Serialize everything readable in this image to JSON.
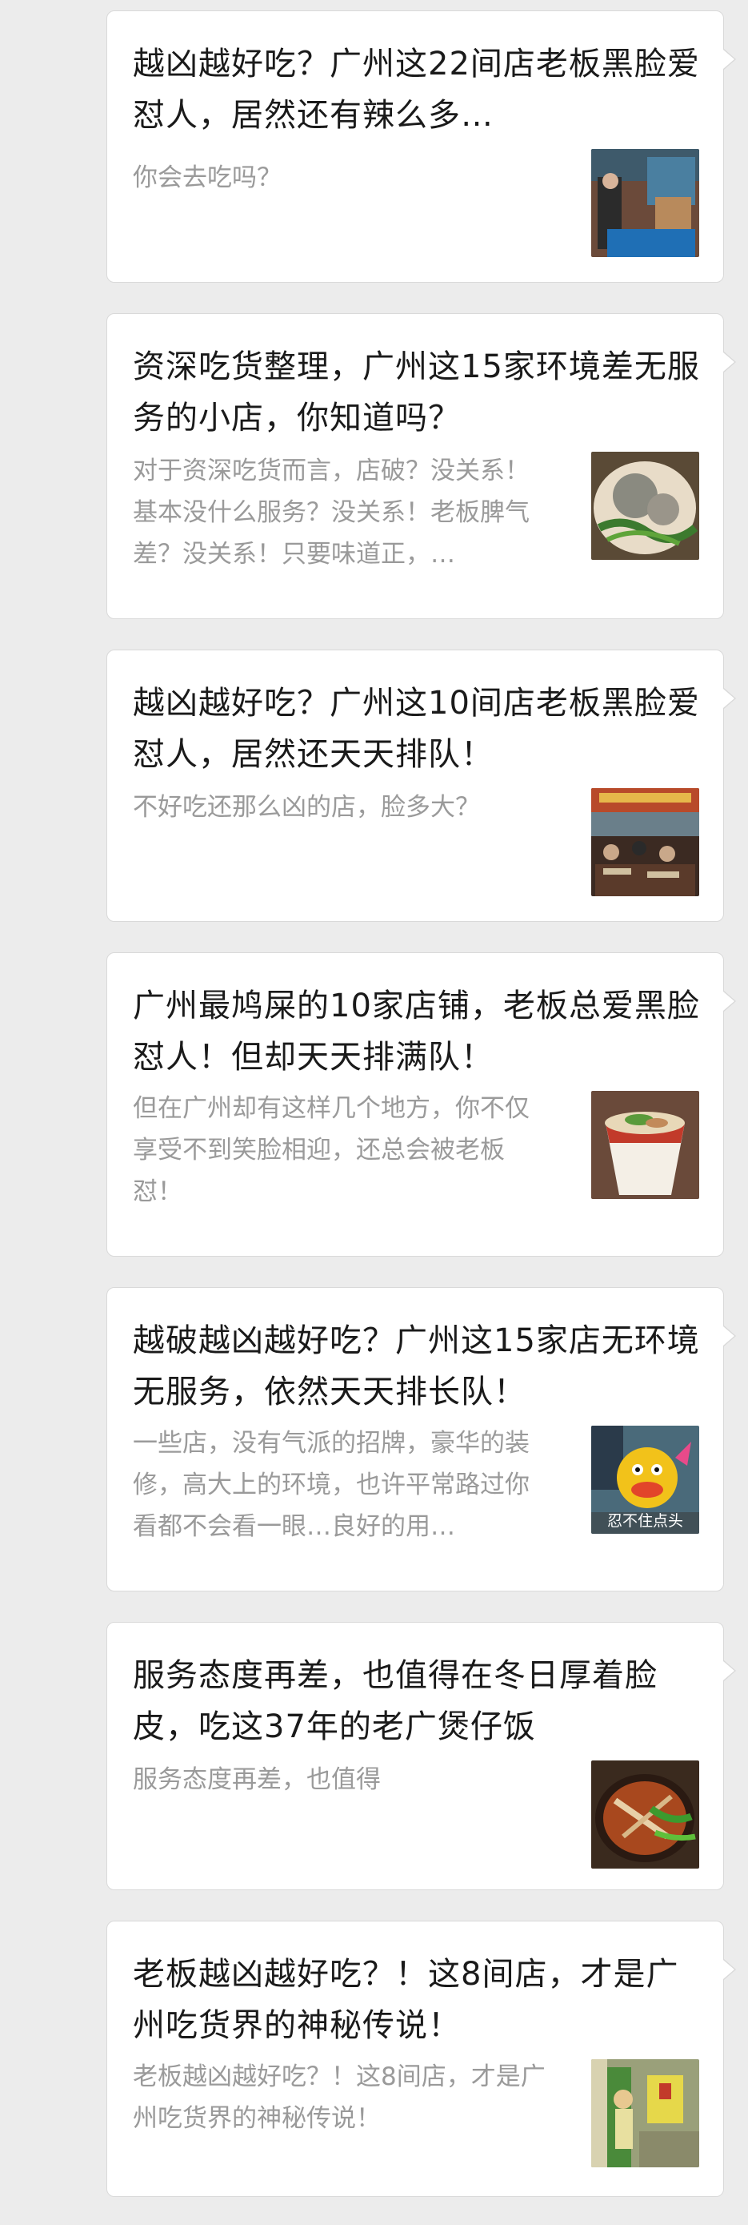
{
  "articles": [
    {
      "title": "越凶越好吃？广州这22间店老板黑脸爱怼人，居然还有辣么多…",
      "desc": "你会去吃吗？",
      "thumb_icon": "restaurant-street-photo"
    },
    {
      "title": "资深吃货整理，广州这15家环境差无服务的小店，你知道吗？",
      "desc": "对于资深吃货而言，店破？没关系！基本没什么服务？没关系！老板脾气差？没关系！只要味道正，…",
      "thumb_icon": "meatball-soup-photo"
    },
    {
      "title": "越凶越好吃？广州这10间店老板黑脸爱怼人，居然还天天排队！",
      "desc": "不好吃还那么凶的店，脸多大？",
      "thumb_icon": "busy-dining-hall-photo"
    },
    {
      "title": "广州最鸠屎的10家店铺，老板总爱黑脸怼人！但却天天排满队！",
      "desc": "但在广州却有这样几个地方，你不仅享受不到笑脸相迎，还总会被老板怼！",
      "thumb_icon": "noodle-cup-photo"
    },
    {
      "title": "越破越凶越好吃？广州这15家店无环境无服务，依然天天排长队！",
      "desc": "一些店，没有气派的招牌，豪华的装修，高大上的环境，也许平常路过你看都不会看一眼…良好的用…",
      "thumb_icon": "cartoon-chick-meme",
      "thumb_caption": "忍不住点头"
    },
    {
      "title": "服务态度再差，也值得在冬日厚着脸皮，吃这37年的老广煲仔饭",
      "desc": "服务态度再差，也值得",
      "thumb_icon": "claypot-rice-photo"
    },
    {
      "title": "老板越凶越好吃？！这8间店，才是广州吃货界的神秘传说！",
      "desc": "老板越凶越好吃？！这8间店，才是广州吃货界的神秘传说！",
      "thumb_icon": "old-shop-door-photo"
    }
  ]
}
